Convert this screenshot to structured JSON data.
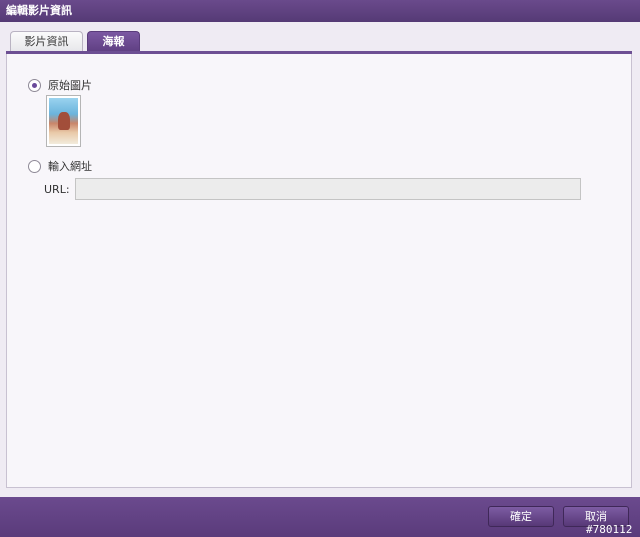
{
  "window": {
    "title": "編輯影片資訊"
  },
  "tabs": [
    {
      "label": "影片資訊",
      "active": false
    },
    {
      "label": "海報",
      "active": true
    }
  ],
  "poster": {
    "original_option": {
      "label": "原始圖片",
      "checked": true
    },
    "url_option": {
      "label": "輸入網址",
      "checked": false
    },
    "url_label": "URL:",
    "url_value": ""
  },
  "footer": {
    "ok_label": "確定",
    "cancel_label": "取消"
  },
  "watermark": "#780112",
  "colors": {
    "accent": "#5f3f82",
    "panel": "#f8f6fa"
  }
}
